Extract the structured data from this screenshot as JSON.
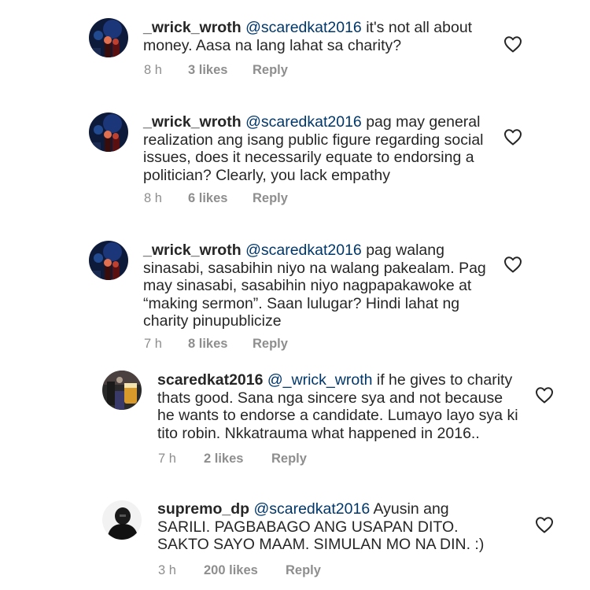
{
  "comments": [
    {
      "username": "_wrick_wroth",
      "mention": "@scaredkat2016",
      "text": "it's not all about money. Aasa na lang lahat sa charity?",
      "time": "8 h",
      "likes": "3 likes",
      "reply": "Reply",
      "avatar_icon": "profile-photo"
    },
    {
      "username": "_wrick_wroth",
      "mention": "@scaredkat2016",
      "text": "pag may general realization ang isang public figure regarding social issues, does it necessarily equate to endorsing a politician? Clearly, you lack empathy",
      "time": "8 h",
      "likes": "6 likes",
      "reply": "Reply",
      "avatar_icon": "profile-photo"
    },
    {
      "username": "_wrick_wroth",
      "mention": "@scaredkat2016",
      "text": "pag walang sinasabi, sasabihin niyo na walang pakealam. Pag may sinasabi, sasabihin niyo nagpapakawoke at “making sermon”. Saan lulugar? Hindi lahat ng charity pinupublicize",
      "time": "7 h",
      "likes": "8 likes",
      "reply": "Reply",
      "avatar_icon": "profile-photo"
    },
    {
      "username": "scaredkat2016",
      "mention": "@_wrick_wroth",
      "text": "if he gives to charity thats good. Sana nga sincere sya and not because he wants to endorse a candidate. Lumayo layo sya ki tito robin. Nkkatrauma what happened in 2016..",
      "time": "7 h",
      "likes": "2 likes",
      "reply": "Reply",
      "avatar_icon": "profile-photo"
    },
    {
      "username": "supremo_dp",
      "mention": "@scaredkat2016",
      "text": "Ayusin ang SARILI. PAGBABAGO ANG USAPAN DITO. SAKTO SAYO MAAM. SIMULAN MO NA DIN. :)",
      "time": "3 h",
      "likes": "200 likes",
      "reply": "Reply",
      "avatar_icon": "profile-photo"
    }
  ],
  "icons": {
    "like": "heart-outline-icon"
  },
  "colors": {
    "text": "#262626",
    "mention": "#00376b",
    "meta": "#8e8e8e"
  }
}
